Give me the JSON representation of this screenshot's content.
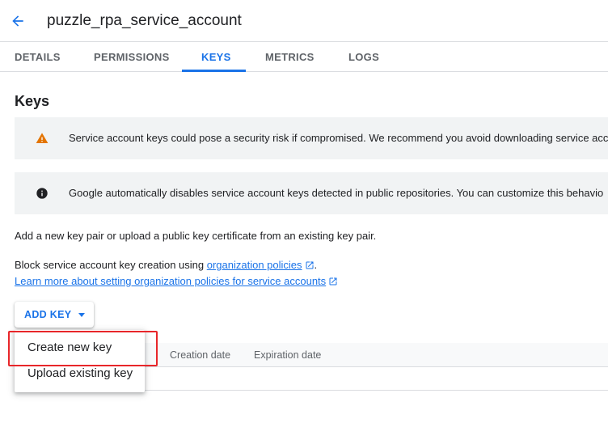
{
  "header": {
    "back_icon": "arrow-back-icon",
    "title": "puzzle_rpa_service_account"
  },
  "tabs": [
    {
      "label": "DETAILS",
      "active": false
    },
    {
      "label": "PERMISSIONS",
      "active": false
    },
    {
      "label": "KEYS",
      "active": true
    },
    {
      "label": "METRICS",
      "active": false
    },
    {
      "label": "LOGS",
      "active": false
    }
  ],
  "keys": {
    "title": "Keys",
    "warning_banner": {
      "icon": "warning-icon",
      "text": "Service account keys could pose a security risk if compromised. We recommend you avoid downloading service acc"
    },
    "info_banner": {
      "icon": "info-icon",
      "text": "Google automatically disables service account keys detected in public repositories. You can customize this behavio"
    },
    "description": "Add a new key pair or upload a public key certificate from an existing key pair.",
    "block_text": "Block service account key creation using ",
    "org_policies_link": "organization policies",
    "block_suffix": ".",
    "learn_more_link": "Learn more about setting organization policies for service accounts",
    "add_key_label": "ADD KEY",
    "table_columns": [
      "Creation date",
      "Expiration date"
    ],
    "menu": {
      "items": [
        "Create new key",
        "Upload existing key"
      ],
      "highlighted": "Create new key"
    }
  },
  "colors": {
    "accent": "#1a73e8",
    "warning": "#e37400",
    "highlight_border": "#e8262a"
  }
}
